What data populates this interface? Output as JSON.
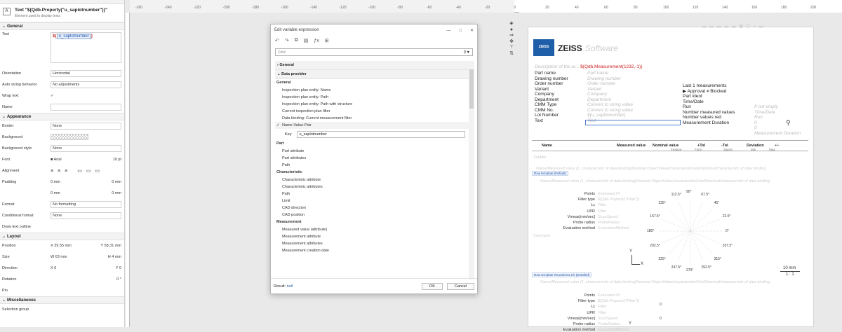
{
  "properties": {
    "title": "Text \"${Qdb.Property(\"u_saplotnumber\")}\"",
    "subtitle": "Element used to display texts",
    "sections": {
      "general": "General",
      "appearance": "Appearance",
      "layout": "Layout",
      "misc": "Miscellaneous"
    },
    "text_label": "Text",
    "text_value_prefix": "${",
    "text_value_var": "u_saplotnumber",
    "text_value_suffix": "}",
    "orientation_label": "Orientation",
    "orientation_value": "Horizontal",
    "autosize_label": "Auto sizing behavior",
    "autosize_value": "No adjustments",
    "wrap_label": "Wrap text",
    "wrap_value": "✓",
    "name_label": "Name",
    "border_label": "Border",
    "border_value": "None",
    "background_label": "Background",
    "bgstyle_label": "Background style",
    "bgstyle_value": "None",
    "font_label": "Font",
    "font_value": "Arial",
    "font_size": "10 pt",
    "alignment_label": "Alignment",
    "padding_label": "Padding",
    "pad1": "0 mm",
    "pad2": "0 mm",
    "pad3": "0 mm",
    "pad4": "0 mm",
    "format_label": "Format",
    "format_value": "No formatting",
    "condfmt_label": "Conditional format",
    "condfmt_value": "None",
    "drawoutline_label": "Draw text outline",
    "position_label": "Position",
    "pos_x": "39.55 mm",
    "pos_y": "58.31 mm",
    "size_label": "Size",
    "size_w": "63 mm",
    "size_h": "4 mm",
    "direction_label": "Direction",
    "dir_x": "0",
    "dir_y": "0",
    "rotation_label": "Rotation",
    "rotation_value": "0 °",
    "pin_label": "Pin",
    "selection_group": "Selection group"
  },
  "ruler": {
    "ticks_left": [
      "-260",
      "-240",
      "-220",
      "-200",
      "-180",
      "-160",
      "-140",
      "-120",
      "-100",
      "-80",
      "-60",
      "-40",
      "-20",
      "0"
    ],
    "ticks_right": [
      "20",
      "40",
      "60",
      "80",
      "100",
      "120",
      "140",
      "160",
      "180",
      "200"
    ]
  },
  "dialog": {
    "title": "Edit variable expression",
    "find_placeholder": "Find",
    "groups": {
      "general": "General",
      "data_provider": "Data provider"
    },
    "general_sub": "General",
    "general_items": [
      "Inspection plan entity: Name",
      "Inspection plan entity: Path",
      "Inspection plan entity: Path with structure",
      "Current inspection plan filter",
      "Data binding: Current measurement filter"
    ],
    "selected_item": "Name-Value-Pair",
    "key_label": "Key",
    "key_value": "u_saplotnumber",
    "part_sub": "Part",
    "part_items": [
      "Part attribute",
      "Part attributes",
      "Path"
    ],
    "char_sub": "Characteristic",
    "char_items": [
      "Characteristic attribute",
      "Characteristic attributes",
      "Path",
      "Limit",
      "CAD direction",
      "CAD position"
    ],
    "meas_sub": "Measurement",
    "meas_items": [
      "Measured value (attribute)",
      "Measurement attribute",
      "Measurement attributes",
      "Measurement creation date"
    ],
    "result_label": "Result:",
    "result_value": "null",
    "ok": "OK",
    "cancel": "Cancel"
  },
  "report": {
    "logo": "ZEISS",
    "brand": "ZEISS",
    "software": "Software",
    "desc_label": "Description of the ar...",
    "desc_value": "${Qdb.Measurement(1232,-1)}",
    "left_labels": [
      "Part name",
      "Drawing number",
      "Order number",
      "Variant",
      "Company",
      "Department",
      "CMM Type",
      "CMM No.",
      "Lot Number",
      "Text"
    ],
    "left_values": [
      "Part name",
      "Drawing number",
      "Order number",
      "Variant",
      "Company",
      "Department",
      "Convert to string value",
      "Convert to string value",
      "${u_saplotnumber}",
      "Text"
    ],
    "right_labels": [
      "Last 1 measurements",
      "▶ Approval ≠ Blocked",
      "Part ident",
      "Time/Date",
      "Run",
      "Number measured values",
      "Number values red",
      "Measurement Duration"
    ],
    "right_values": [
      "",
      "",
      "If not empty",
      "Time/Date",
      "Run",
      "0",
      "0",
      "Measurement Duration"
    ],
    "table_headers": {
      "name": "Name",
      "measured": "Measured value",
      "nominal": "Nominal value",
      "utol": "+Tol",
      "ltol": "-Tol",
      "deviation": "Deviation",
      "plusminus": "+/-"
    },
    "table_subheaders": [
      "Feature",
      "Form",
      "Sigma",
      "Min",
      "Max"
    ],
    "subtitle": "Subtitle",
    "comment": "Comment",
    "row_template_default": "Row template (Default)",
    "row_template_roundness": "Row template Roundness,Cir (Detailed)",
    "ghost_line": "Name/Measured value (1, characteristic of data binding)Nominal ObjectValue/characteristicField/Nominal/characteristic of data binding",
    "polar_labels": [
      "Points",
      "Filter type",
      "Lc",
      "UPR",
      "Vmeas[mm/sec]",
      "Probe radius",
      "Evaluation method"
    ],
    "polar_values": [
      "Evaluated Pt",
      "${Qdb.Property(\"Filter\")}",
      "Filter",
      "Filter",
      "ScanSpeed",
      "ProbeRadius",
      "EvaluationMethod"
    ],
    "angles": [
      "90°",
      "67.5°",
      "45°",
      "22.5°",
      "0°",
      "337.5°",
      "315°",
      "292.5°",
      "270°",
      "247.5°",
      "225°",
      "202.5°",
      "180°",
      "157.5°",
      "135°",
      "112.5°"
    ],
    "axis_y": "Y",
    "axis_x": "X",
    "scale": "10 mm",
    "ratio": "1 : 1",
    "points_zero": "0"
  },
  "colors": {
    "accent": "#2255aa",
    "zeiss_blue": "#1f5ea8",
    "red": "#cc2222"
  }
}
